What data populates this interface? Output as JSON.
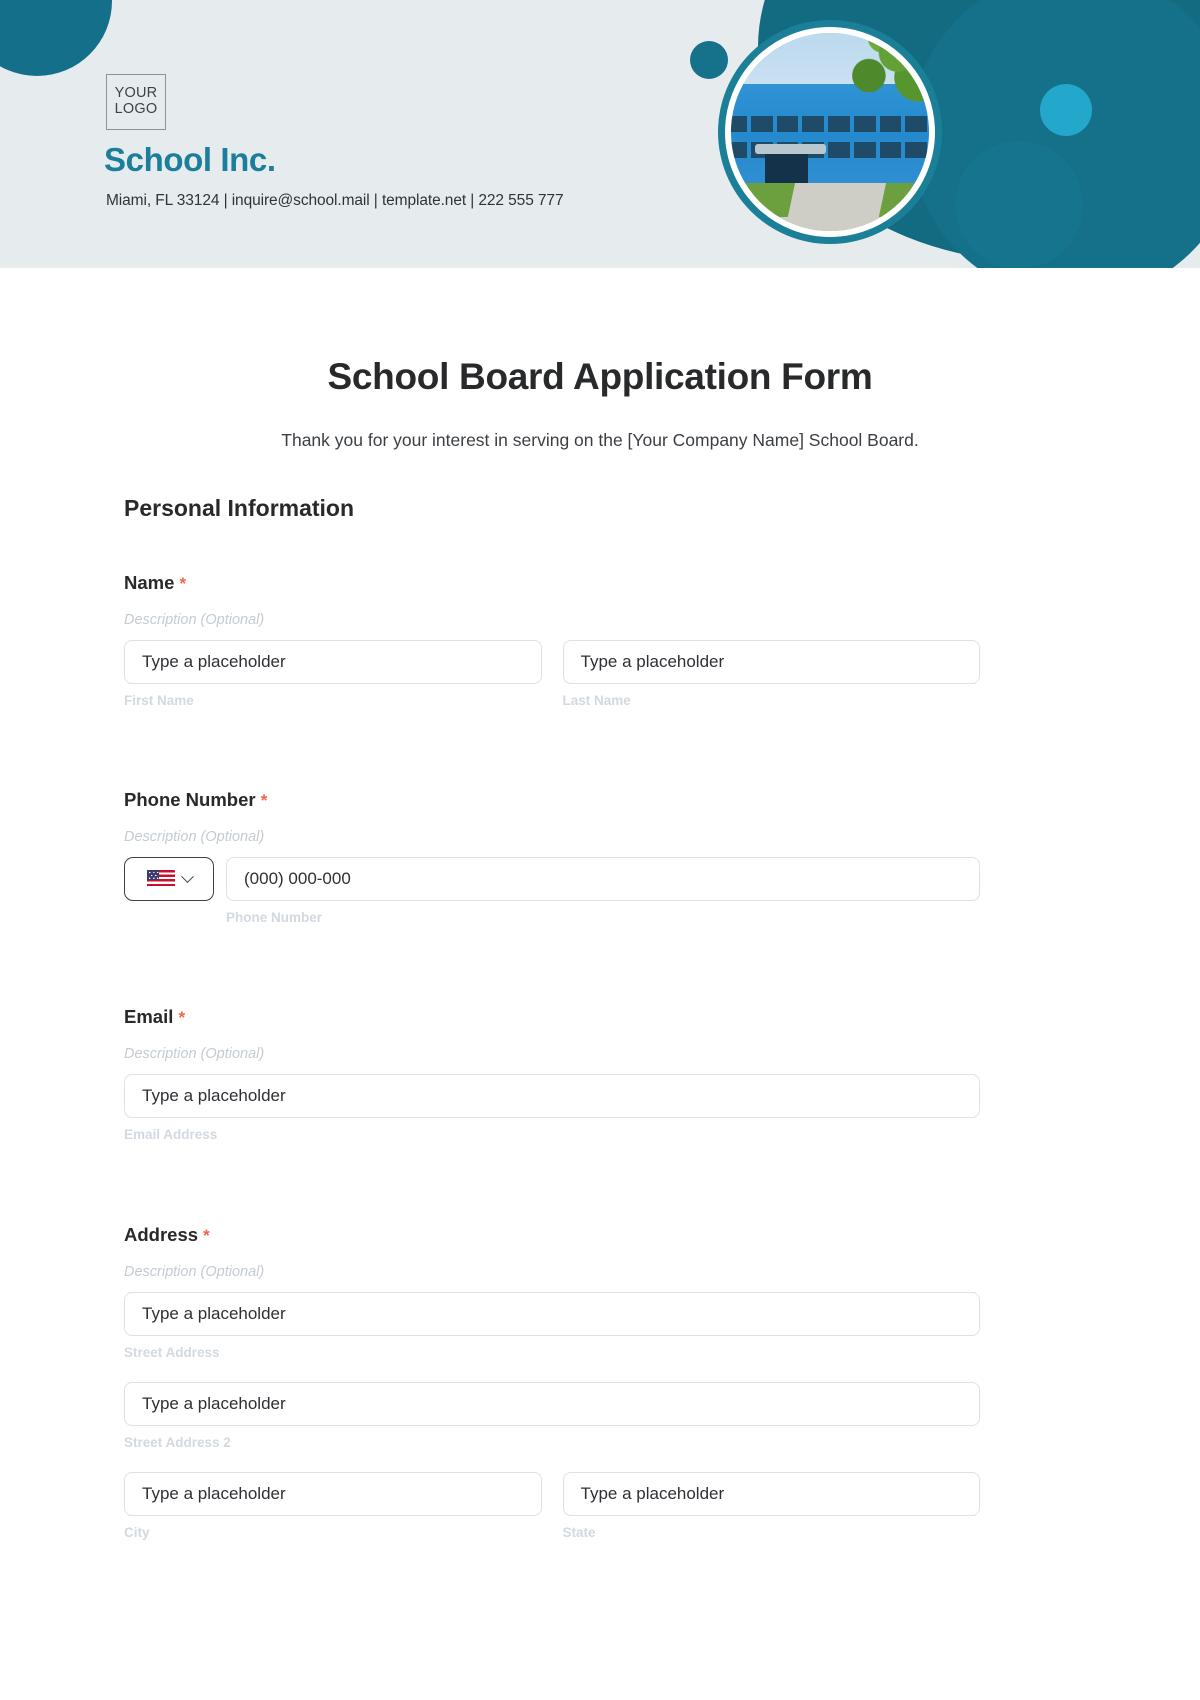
{
  "header": {
    "logo_line1": "YOUR",
    "logo_line2": "LOGO",
    "company_name": "School Inc.",
    "contact_line": "Miami, FL 33124 | inquire@school.mail | template.net | 222 555 777",
    "photo_alt": "school-building-photo",
    "accent_color": "#1b7e9a",
    "header_bg": "#e6ecee"
  },
  "form": {
    "title": "School Board Application Form",
    "subtitle": "Thank you for your interest in serving on the [Your Company Name] School Board.",
    "section_title": "Personal Information",
    "required_marker": "*",
    "description_text": "Description (Optional)",
    "placeholder": "Type a placeholder",
    "required_color": "#f4624a",
    "fields": [
      {
        "label": "Name",
        "description": "Description (Optional)",
        "inputs": [
          {
            "placeholder": "Type a placeholder",
            "sub_label": "First Name"
          },
          {
            "placeholder": "Type a placeholder",
            "sub_label": "Last Name"
          }
        ]
      },
      {
        "label": "Phone Number",
        "description": "Description (Optional)",
        "country_code_icon": "us-flag-icon",
        "dropdown_icon": "chevron-down-icon",
        "inputs": [
          {
            "placeholder": "(000) 000-000",
            "sub_label": "Phone Number"
          }
        ]
      },
      {
        "label": "Email",
        "description": "Description (Optional)",
        "inputs": [
          {
            "placeholder": "Type a placeholder",
            "sub_label": "Email Address"
          }
        ]
      },
      {
        "label": "Address",
        "description": "Description (Optional)",
        "inputs": [
          {
            "placeholder": "Type a placeholder",
            "sub_label": "Street Address"
          },
          {
            "placeholder": "Type a placeholder",
            "sub_label": "Street Address 2"
          },
          {
            "placeholder": "Type a placeholder",
            "sub_label": "City"
          },
          {
            "placeholder": "Type a placeholder",
            "sub_label": "State"
          }
        ]
      }
    ]
  }
}
